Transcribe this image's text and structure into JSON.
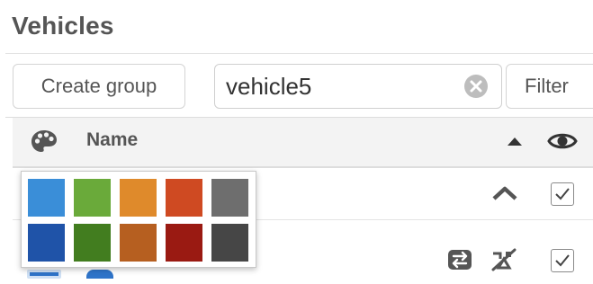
{
  "page": {
    "title": "Vehicles"
  },
  "toolbar": {
    "create_group_label": "Create group",
    "search_value": "vehicle5",
    "filter_label": "Filter"
  },
  "table": {
    "columns": {
      "name": "Name"
    }
  },
  "color_picker": {
    "swatches": [
      "#3a8ed8",
      "#6aaa3a",
      "#df8a2b",
      "#cf4a22",
      "#6e6e6e",
      "#1f53a8",
      "#427d1f",
      "#b65f20",
      "#9a1a12",
      "#464646"
    ]
  },
  "colors": {
    "title": "#555555",
    "header_bg": "#f3f3f3",
    "icon": "#555555"
  }
}
